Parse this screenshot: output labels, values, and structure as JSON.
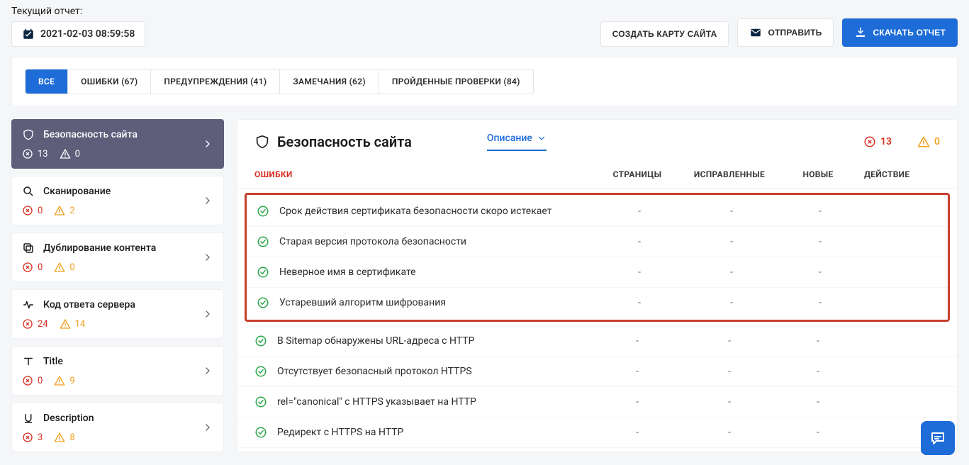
{
  "topbar": {
    "report_label": "Текущий отчет:",
    "datetime": "2021-02-03 08:59:58",
    "create_sitemap": "СОЗДАТЬ КАРТУ САЙТА",
    "send": "ОТПРАВИТЬ",
    "download": "СКАЧАТЬ ОТЧЕТ"
  },
  "tabs": {
    "all": "ВСЕ",
    "errors": "ОШИБКИ (67)",
    "warnings": "ПРЕДУПРЕЖДЕНИЯ (41)",
    "notes": "ЗАМЕЧАНИЯ (62)",
    "passed": "ПРОЙДЕННЫЕ ПРОВЕРКИ (84)"
  },
  "sidebar": [
    {
      "label": "Безопасность сайта",
      "err": "13",
      "warn": "0"
    },
    {
      "label": "Сканирование",
      "err": "0",
      "warn": "2"
    },
    {
      "label": "Дублирование контента",
      "err": "0",
      "warn": "0"
    },
    {
      "label": "Код ответа сервера",
      "err": "24",
      "warn": "14"
    },
    {
      "label": "Title",
      "err": "0",
      "warn": "9"
    },
    {
      "label": "Description",
      "err": "3",
      "warn": "8"
    }
  ],
  "main": {
    "title": "Безопасность сайта",
    "desc": "Описание",
    "err_count": "13",
    "warn_count": "0",
    "cols": {
      "name": "ОШИБКИ",
      "pages": "СТРАНИЦЫ",
      "fixed": "ИСПРАВЛЕННЫЕ",
      "new_": "НОВЫЕ",
      "act": "ДЕЙСТВИЕ"
    },
    "rows_hl": [
      {
        "name": "Срок действия сертификата безопасности скоро истекает",
        "pages": "-",
        "fixed": "-",
        "new_": "-"
      },
      {
        "name": "Старая версия протокола безопасности",
        "pages": "-",
        "fixed": "-",
        "new_": "-"
      },
      {
        "name": "Неверное имя в сертификате",
        "pages": "-",
        "fixed": "-",
        "new_": "-"
      },
      {
        "name": "Устаревший алгоритм шифрования",
        "pages": "-",
        "fixed": "-",
        "new_": "-"
      }
    ],
    "rows": [
      {
        "name": "В Sitemap обнаружены URL-адреса с HTTP",
        "pages": "-",
        "fixed": "-",
        "new_": "-"
      },
      {
        "name": "Отсутствует безопасный протокол HTTPS",
        "pages": "-",
        "fixed": "-",
        "new_": "-"
      },
      {
        "name": "rel=\"canonical\" с HTTPS указывает на HTTP",
        "pages": "-",
        "fixed": "-",
        "new_": "-"
      },
      {
        "name": "Редирект с HTTPS на HTTP",
        "pages": "-",
        "fixed": "-",
        "new_": "-"
      }
    ]
  }
}
